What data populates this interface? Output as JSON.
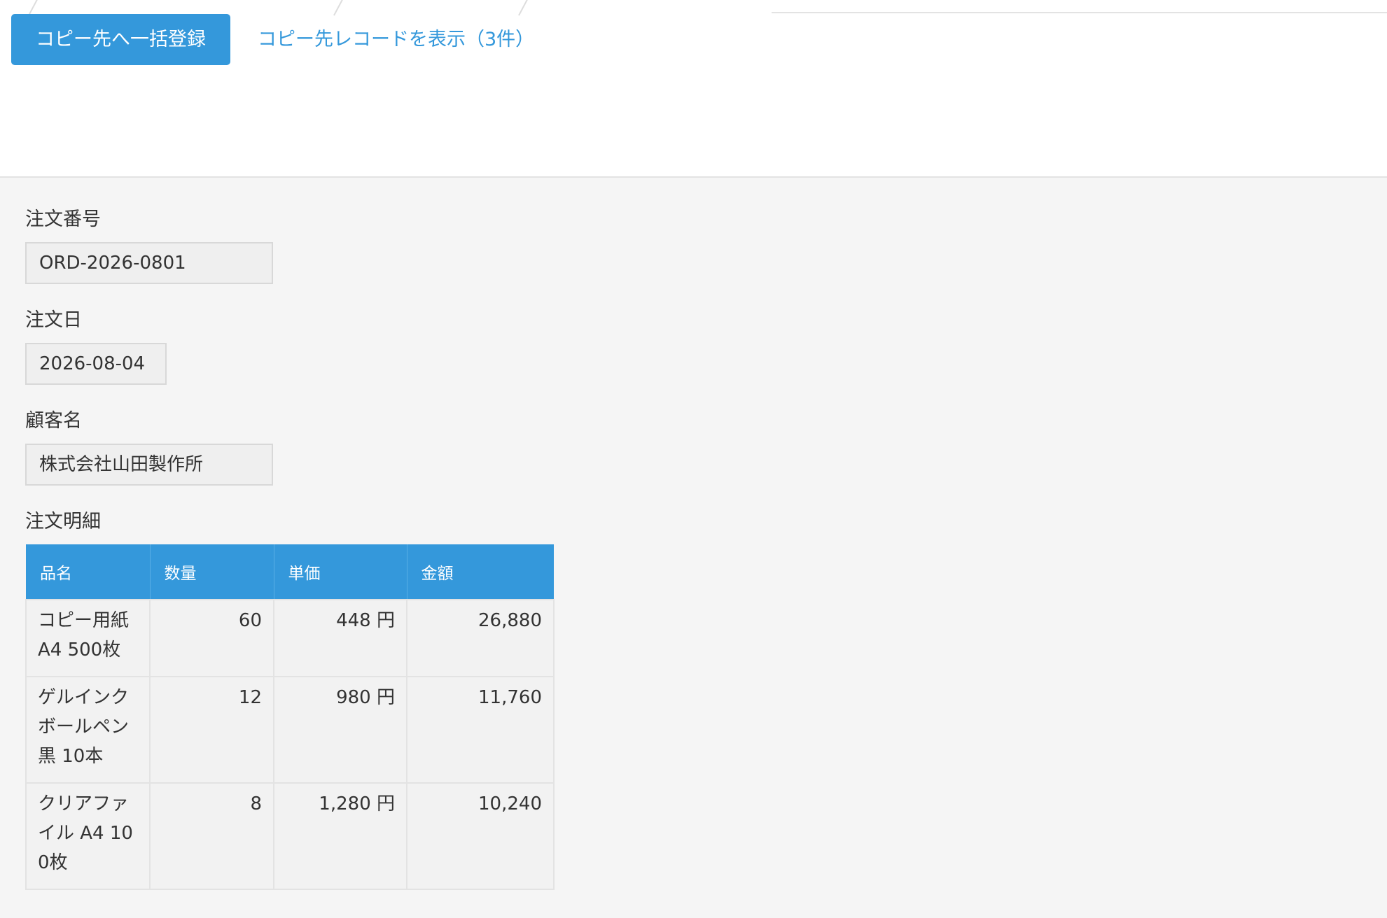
{
  "toolbar": {
    "bulk_register_label": "コピー先へ一括登録",
    "view_records_link": "コピー先レコードを表示（3件）"
  },
  "fields": {
    "order_number": {
      "label": "注文番号",
      "value": "ORD-2026-0801"
    },
    "order_date": {
      "label": "注文日",
      "value": "2026-08-04"
    },
    "customer_name": {
      "label": "顧客名",
      "value": "株式会社山田製作所"
    }
  },
  "details": {
    "label": "注文明細",
    "columns": [
      "品名",
      "数量",
      "単価",
      "金額"
    ],
    "rows": [
      {
        "name": "コピー用紙 A4 500枚",
        "qty": "60",
        "unit_price": "448 円",
        "amount": "26,880"
      },
      {
        "name": "ゲルインクボールペン 黒 10本",
        "qty": "12",
        "unit_price": "980 円",
        "amount": "11,760"
      },
      {
        "name": "クリアファイル A4 100枚",
        "qty": "8",
        "unit_price": "1,280 円",
        "amount": "10,240"
      }
    ]
  },
  "colors": {
    "accent": "#3498db",
    "page_background": "#f5f5f5",
    "input_background": "#efefef"
  }
}
